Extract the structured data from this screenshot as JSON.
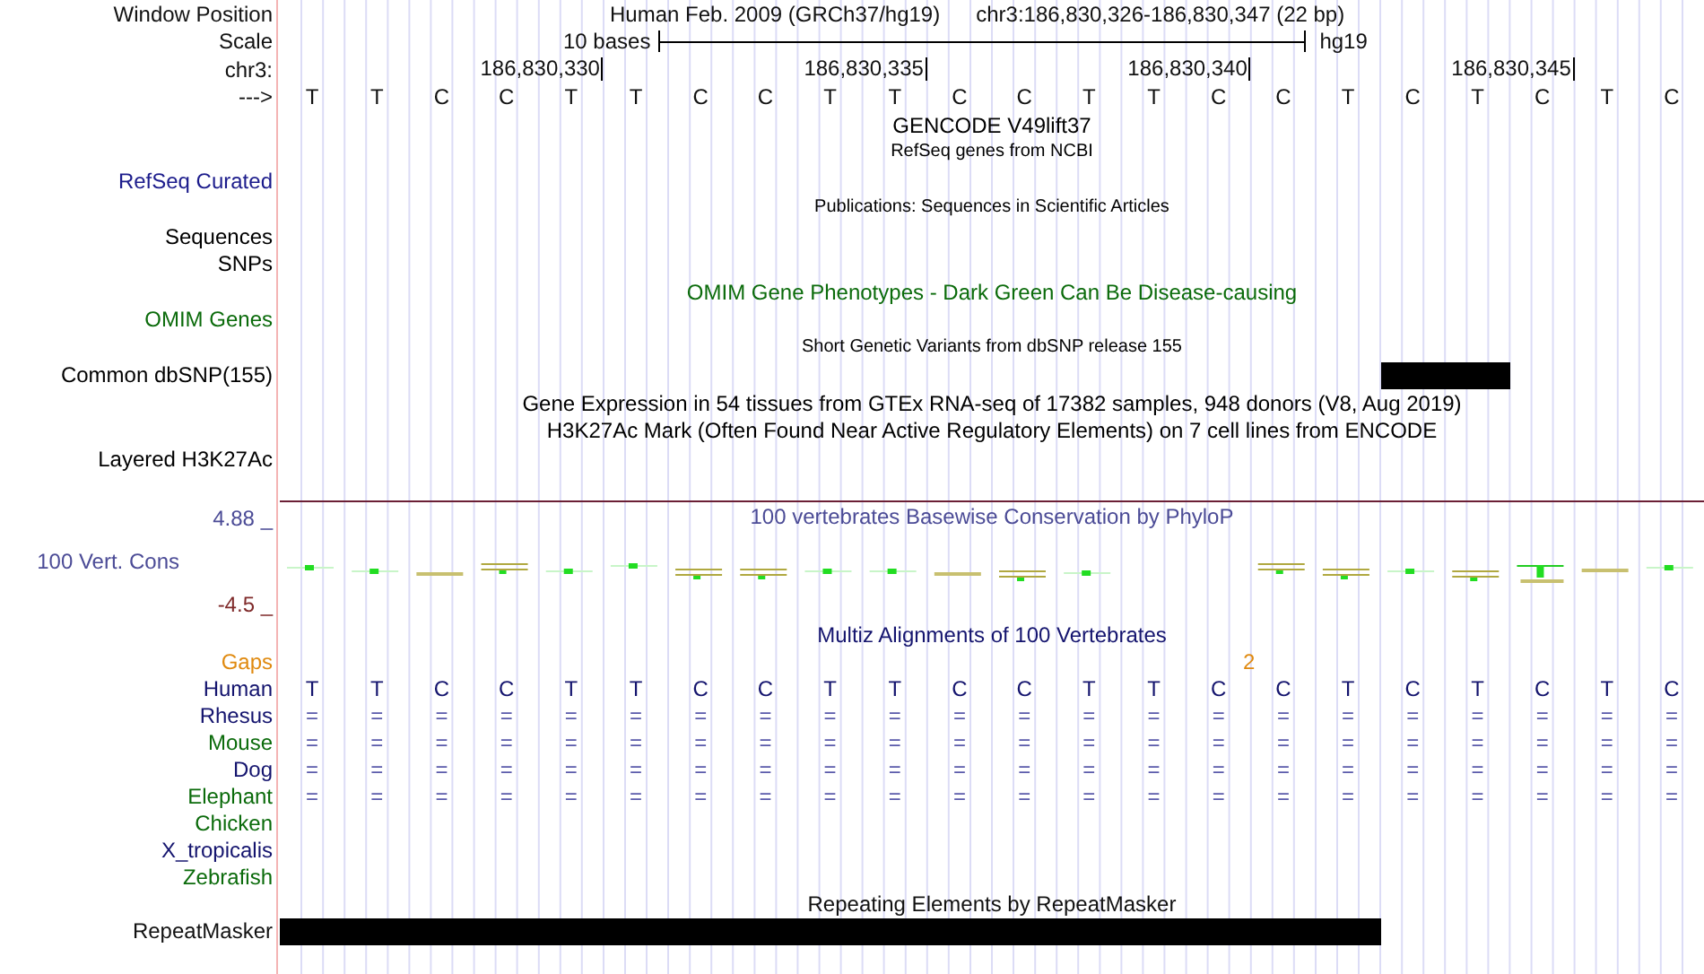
{
  "header": {
    "window_position_label": "Window Position",
    "scale_label": "Scale",
    "chrom_label": "chr3:",
    "strand_label": "--->",
    "assembly": "Human Feb. 2009 (GRCh37/hg19)",
    "position": "chr3:186,830,326-186,830,347 (22 bp)",
    "scale_text": "10 bases",
    "scale_db": "hg19",
    "ticks": [
      "186,830,330",
      "186,830,335",
      "186,830,340",
      "186,830,345"
    ]
  },
  "bases": [
    "T",
    "T",
    "C",
    "C",
    "T",
    "T",
    "C",
    "C",
    "T",
    "T",
    "C",
    "C",
    "T",
    "T",
    "C",
    "C",
    "T",
    "C",
    "T",
    "C",
    "T",
    "C"
  ],
  "tracks": [
    {
      "kind": "title",
      "text": "GENCODE V49lift37",
      "color": "#000000"
    },
    {
      "kind": "subtitle",
      "text": "RefSeq genes from NCBI",
      "color": "#000000"
    },
    {
      "kind": "label",
      "label": "RefSeq Curated",
      "color": "#1c1c8c"
    },
    {
      "kind": "subtitle",
      "text": "Publications: Sequences in Scientific Articles",
      "color": "#000000"
    },
    {
      "kind": "label",
      "label": "Sequences",
      "color": "#000000"
    },
    {
      "kind": "label",
      "label": "SNPs",
      "color": "#000000"
    },
    {
      "kind": "title",
      "text": "OMIM Gene Phenotypes - Dark Green Can Be Disease-causing",
      "color": "#0b6b0b"
    },
    {
      "kind": "label",
      "label": "OMIM Genes",
      "color": "#0b6b0b"
    },
    {
      "kind": "subtitle",
      "text": "Short Genetic Variants from dbSNP release 155",
      "color": "#000000"
    },
    {
      "kind": "blocks",
      "label": "Common dbSNP(155)",
      "color": "#000000",
      "covered": [
        false,
        false,
        false,
        false,
        false,
        false,
        false,
        false,
        false,
        false,
        false,
        false,
        false,
        false,
        false,
        false,
        false,
        true,
        true,
        false,
        false,
        false
      ]
    },
    {
      "kind": "title",
      "text": "Gene Expression in 54 tissues from GTEx RNA-seq of 17382 samples, 948 donors (V8, Aug 2019)",
      "color": "#000000"
    },
    {
      "kind": "title",
      "text": "H3K27Ac Mark (Often Found Near Active Regulatory Elements) on 7 cell lines from ENCODE",
      "color": "#000000"
    },
    {
      "kind": "label",
      "label": "Layered H3K27Ac",
      "color": "#000000"
    }
  ],
  "conservation": {
    "title": "100 vertebrates Basewise Conservation by PhyloP",
    "label": "100 Vert. Cons",
    "max": "4.88 _",
    "min": "-4.5 _"
  },
  "multiz": {
    "title": "Multiz Alignments of 100 Vertebrates",
    "gaps_label": "Gaps",
    "gap_marks": [
      "2"
    ],
    "species": [
      {
        "name": "Human",
        "color": "#14146e",
        "bases": [
          "T",
          "T",
          "C",
          "C",
          "T",
          "T",
          "C",
          "C",
          "T",
          "T",
          "C",
          "C",
          "T",
          "T",
          "C",
          "C",
          "T",
          "C",
          "T",
          "C",
          "T",
          "C"
        ]
      },
      {
        "name": "Rhesus",
        "color": "#14146e",
        "bases": [
          "=",
          "=",
          "=",
          "=",
          "=",
          "=",
          "=",
          "=",
          "=",
          "=",
          "=",
          "=",
          "=",
          "=",
          "=",
          "=",
          "=",
          "=",
          "=",
          "=",
          "=",
          "="
        ]
      },
      {
        "name": "Mouse",
        "color": "#0b6b0b",
        "bases": [
          "=",
          "=",
          "=",
          "=",
          "=",
          "=",
          "=",
          "=",
          "=",
          "=",
          "=",
          "=",
          "=",
          "=",
          "=",
          "=",
          "=",
          "=",
          "=",
          "=",
          "=",
          "="
        ]
      },
      {
        "name": "Dog",
        "color": "#14146e",
        "bases": [
          "=",
          "=",
          "=",
          "=",
          "=",
          "=",
          "=",
          "=",
          "=",
          "=",
          "=",
          "=",
          "=",
          "=",
          "=",
          "=",
          "=",
          "=",
          "=",
          "=",
          "=",
          "="
        ]
      },
      {
        "name": "Elephant",
        "color": "#0b6b0b",
        "bases": [
          "=",
          "=",
          "=",
          "=",
          "=",
          "=",
          "=",
          "=",
          "=",
          "=",
          "=",
          "=",
          "=",
          "=",
          "=",
          "=",
          "=",
          "=",
          "=",
          "=",
          "=",
          "="
        ]
      },
      {
        "name": "Chicken",
        "color": "#0b6b0b"
      },
      {
        "name": "X_tropicalis",
        "color": "#14146e"
      },
      {
        "name": "Zebrafish",
        "color": "#0b6b0b"
      }
    ]
  },
  "repeats": {
    "title": "Repeating Elements by RepeatMasker",
    "label": "RepeatMasker",
    "covered": [
      true,
      true,
      true,
      true,
      true,
      true,
      true,
      true,
      true,
      true,
      true,
      true,
      true,
      true,
      true,
      true,
      true,
      false,
      false,
      false,
      false,
      false
    ]
  }
}
